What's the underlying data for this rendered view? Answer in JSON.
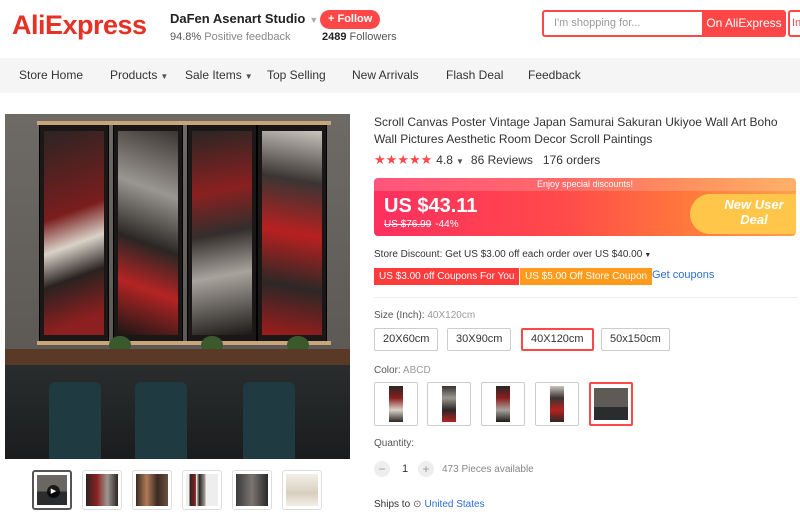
{
  "header": {
    "logo": "AliExpress",
    "store_name": "DaFen Asenart Studio",
    "positive_feedback_value": "94.8%",
    "positive_feedback_label": "Positive feedback",
    "follow_label": "+ Follow",
    "followers_count": "2489",
    "followers_label": "Followers",
    "search_placeholder": "I'm shopping for...",
    "search_button": "On AliExpress",
    "search_extra": "In"
  },
  "nav": {
    "items": [
      {
        "label": "Store Home"
      },
      {
        "label": "Products",
        "dropdown": true
      },
      {
        "label": "Sale Items",
        "dropdown": true
      },
      {
        "label": "Top Selling"
      },
      {
        "label": "New Arrivals"
      },
      {
        "label": "Flash Deal"
      },
      {
        "label": "Feedback"
      }
    ]
  },
  "product": {
    "title": "Scroll Canvas Poster Vintage Japan Samurai Sakuran Ukiyoe Wall Art Boho Wall Pictures Aesthetic Room Decor Scroll Paintings",
    "rating": 4.8,
    "rating_text": "4.8",
    "stars": "★★★★★",
    "reviews": "86 Reviews",
    "orders": "176 orders"
  },
  "price": {
    "banner": "Enjoy special discounts!",
    "current": "US $43.11",
    "original": "US $76.99",
    "discount": "-44%",
    "deal_badge": "New User Deal"
  },
  "discounts": {
    "store_discount": "Store Discount: Get US $3.00 off each order over US $40.00",
    "coupon_1": "US $3.00 off Coupons For You",
    "coupon_2": "US $5.00 Off Store Coupon",
    "get_coupons": "Get coupons"
  },
  "size": {
    "label": "Size (Inch):",
    "selected": "40X120cm",
    "options": [
      "20X60cm",
      "30X90cm",
      "40X120cm",
      "50x150cm"
    ]
  },
  "color": {
    "label": "Color:",
    "selected": "ABCD",
    "options_count": 5
  },
  "quantity": {
    "label": "Quantity:",
    "minus": "−",
    "plus": "+",
    "value": "1",
    "available": "473 Pieces available"
  },
  "shipping": {
    "label": "Ships to",
    "country": "United States"
  },
  "colors": {
    "brand_red": "#e43225",
    "accent": "#ff4747",
    "link": "#2e6ed6",
    "coupon_orange": "#ff9a1a"
  },
  "icons": {
    "play": "play-icon",
    "pin": "location-pin-icon",
    "caret": "chevron-down-icon"
  }
}
